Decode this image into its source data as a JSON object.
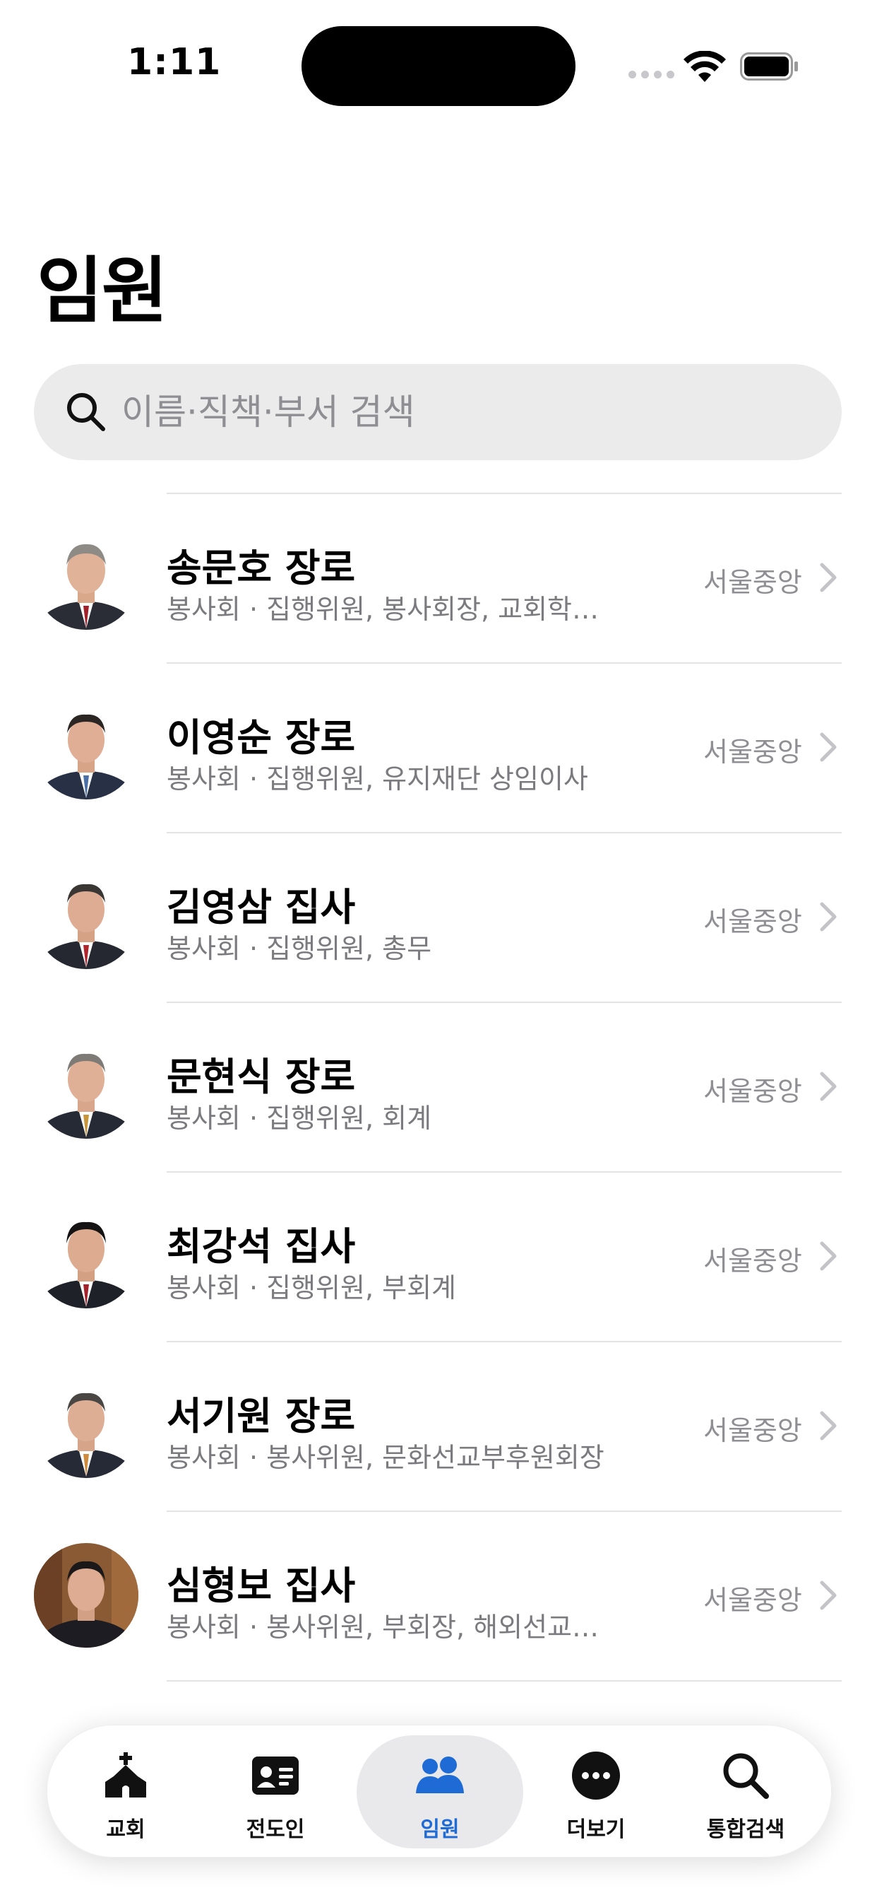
{
  "status": {
    "time": "1:11"
  },
  "header": {
    "title": "임원"
  },
  "search": {
    "placeholder": "이름·직책·부서 검색"
  },
  "members": [
    {
      "name": "송문호 장로",
      "role": "봉사회 · 집행위원, 봉사회장, 교회학교…",
      "region": "서울중앙"
    },
    {
      "name": "이영순 장로",
      "role": "봉사회 · 집행위원, 유지재단 상임이사",
      "region": "서울중앙"
    },
    {
      "name": "김영삼 집사",
      "role": "봉사회 · 집행위원, 총무",
      "region": "서울중앙"
    },
    {
      "name": "문현식 장로",
      "role": "봉사회 · 집행위원, 회계",
      "region": "서울중앙"
    },
    {
      "name": "최강석 집사",
      "role": "봉사회 · 집행위원, 부회계",
      "region": "서울중앙"
    },
    {
      "name": "서기원 장로",
      "role": "봉사회 · 봉사위원, 문화선교부후원회장",
      "region": "서울중앙"
    },
    {
      "name": "심형보 집사",
      "role": "봉사회 · 봉사위원, 부회장, 해외선교담당",
      "region": "서울중앙"
    }
  ],
  "tabs": [
    {
      "label": "교회",
      "icon": "church-icon"
    },
    {
      "label": "전도인",
      "icon": "id-card-icon"
    },
    {
      "label": "임원",
      "icon": "people-icon",
      "active": true
    },
    {
      "label": "더보기",
      "icon": "more-icon"
    },
    {
      "label": "통합검색",
      "icon": "search-icon"
    }
  ],
  "colors": {
    "accent": "#1e6bd6",
    "search_bg": "#ebebeb",
    "secondary_text": "#7a7a7f"
  }
}
